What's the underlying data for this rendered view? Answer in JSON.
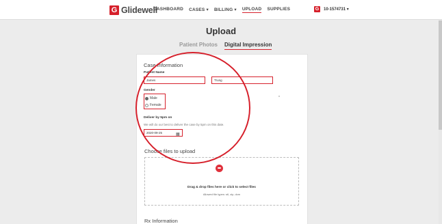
{
  "brand": {
    "logo_letter": "G",
    "name": "Glidewell"
  },
  "nav": {
    "items": [
      {
        "label": "DASHBOARD"
      },
      {
        "label": "CASES ▾"
      },
      {
        "label": "BILLING ▾"
      },
      {
        "label": "UPLOAD"
      },
      {
        "label": "SUPPLIES"
      }
    ]
  },
  "account": {
    "logo_letter": "G",
    "label": "10-1574731 ▾"
  },
  "page": {
    "title": "Upload"
  },
  "tabs": [
    {
      "label": "Patient Photos"
    },
    {
      "label": "Digital Impression"
    }
  ],
  "case_info": {
    "title": "Case Information",
    "patient_name_label": "Patient Name",
    "first_name": "James",
    "last_name": "Trung",
    "gender_label": "Gender",
    "gender_options": [
      "Male",
      "Female"
    ],
    "deliver_label": "Deliver by 5pm on",
    "deliver_note": "We will do our best to deliver the case by 5pm on this date.",
    "deliver_date": "2020-09-25"
  },
  "upload": {
    "title": "Choose files to upload",
    "drop_text": "Drag & drop files here or click to select files",
    "allowed_text": "Allowed file types: stl, zip, dcm"
  },
  "rx": {
    "title": "Rx Information"
  },
  "colors": {
    "accent": "#d6202b",
    "background": "#ececec"
  }
}
